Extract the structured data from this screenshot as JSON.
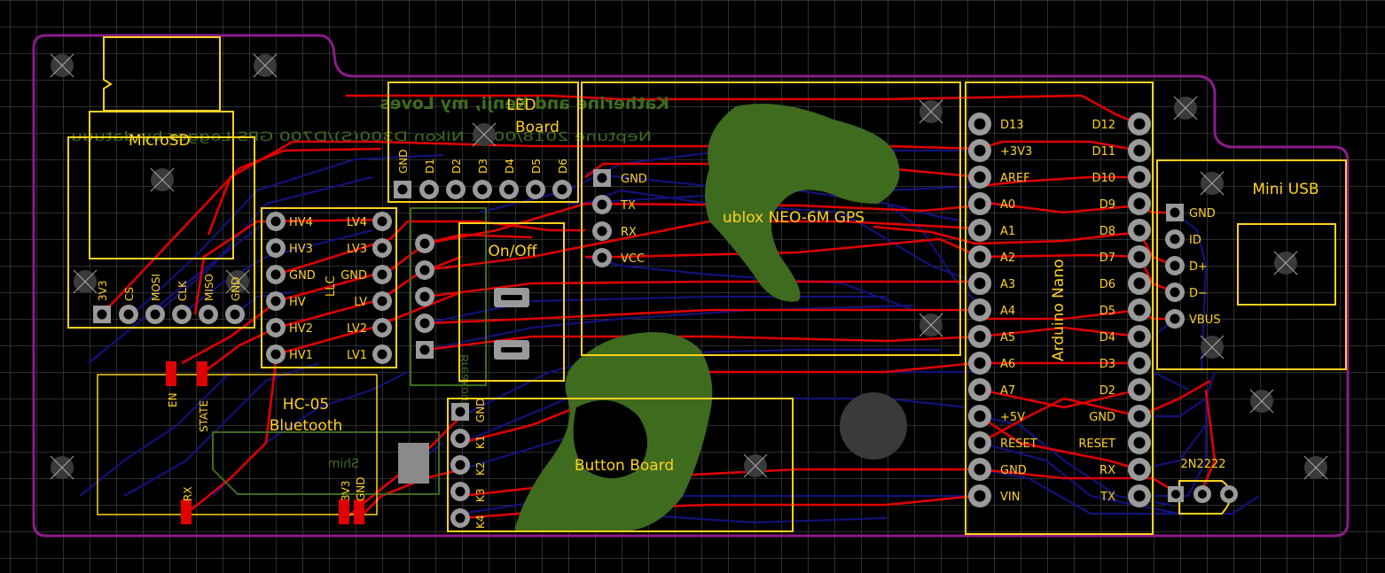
{
  "board": {
    "bg_color": "#000000",
    "grid_color": "#5a5a5a",
    "outline_color": "#8B1C8B",
    "silk_color": "#FFD21E",
    "top_trace_color": "#E00000",
    "bottom_trace_color": "#12127A",
    "mirror_silk_color": "#3F6B1F"
  },
  "mirrored_text": {
    "dedication": "Katherine and Kenji, my Loves",
    "credit": "Neptune 2018/0001 Nikon D300(S)/D700 GPS Logger by datuuu",
    "shim": "Shim",
    "breakout": "Breakout"
  },
  "microsd": {
    "title": "MicroSD",
    "pins": [
      "3V3",
      "CS",
      "MOSI",
      "CLK",
      "MISO",
      "GND"
    ]
  },
  "led_board": {
    "title_line1": "LED",
    "title_line2": "Board",
    "pins": [
      "GND",
      "D1",
      "D2",
      "D3",
      "D4",
      "D5",
      "D6"
    ]
  },
  "llc": {
    "title": "LLC",
    "left_pins": [
      "HV4",
      "HV3",
      "GND",
      "HV",
      "HV2",
      "HV1"
    ],
    "right_pins": [
      "LV4",
      "LV3",
      "GND",
      "LV",
      "LV2",
      "LV1"
    ]
  },
  "onoff": {
    "title": "On/Off"
  },
  "gps": {
    "title": "ublox NEO-6M GPS",
    "pins": [
      "GND",
      "TX",
      "RX",
      "VCC"
    ]
  },
  "arduino": {
    "title": "Arduino Nano",
    "left_pins": [
      "D13",
      "+3V3",
      "AREF",
      "A0",
      "A1",
      "A2",
      "A3",
      "A4",
      "A5",
      "A6",
      "A7",
      "+5V",
      "RESET",
      "GND",
      "VIN"
    ],
    "right_pins": [
      "D12",
      "D11",
      "D10",
      "D9",
      "D8",
      "D7",
      "D6",
      "D5",
      "D4",
      "D3",
      "D2",
      "GND",
      "RESET",
      "RX",
      "TX"
    ]
  },
  "usb": {
    "title": "Mini USB",
    "pins": [
      "GND",
      "ID",
      "D+",
      "D−",
      "VBUS"
    ]
  },
  "bluetooth": {
    "title_line1": "HC-05",
    "title_line2": "Bluetooth",
    "pins": [
      "EN",
      "STATE",
      "RX",
      "3V3",
      "GND"
    ]
  },
  "button_board": {
    "title": "Button Board",
    "pins": [
      "GND",
      "K1",
      "K2",
      "K3",
      "K4"
    ]
  },
  "transistor": {
    "title": "2N2222"
  }
}
